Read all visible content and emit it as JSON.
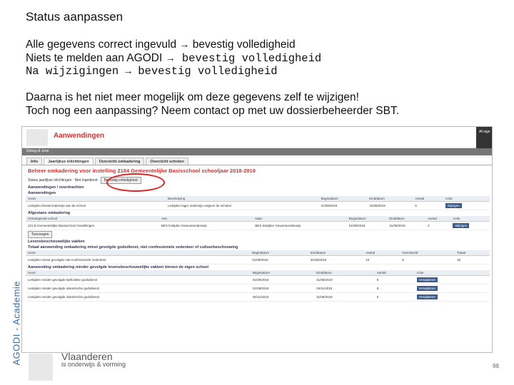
{
  "slide": {
    "title": "Status aanpassen",
    "side_label": "AGODI - Academie",
    "page_number": "98",
    "line1_text": "Alle gegevens correct ingevuld ",
    "line1_end": " bevestig volledigheid",
    "line2_text": "Niets te melden aan AGODI ",
    "line2_end": " bevestig volledigheid",
    "line3_text": "Na wijzigingen ",
    "line3_end": " bevestig volledigheid",
    "arrow": "→",
    "para1": "Daarna is het niet meer mogelijk om deze gegevens zelf te wijzigen!",
    "para2": "Toch nog een aanpassing? Neem contact op met uw dossierbeheerder SBT."
  },
  "app": {
    "title": "Aanwendingen",
    "user": "Debug & Jose",
    "top_right": "Af-sign",
    "tabs": [
      "Info",
      "Jaarlijkse inlichtingen",
      "Overzicht omkadering",
      "Overzicht scholen"
    ],
    "heading": "Beheer omkadering voor instelling 2184 Gemeentelijke Basisschool schooljaar 2018-2019",
    "status_label": "Status jaarlijkse inlichtingen : Niet ingediend",
    "confirm_button": "Bevestig volledigheid",
    "breadcrumb": "Aanwendingen / overdrachten",
    "sec1": "Aanwendingen",
    "sec1_cols": [
      "Soort",
      "Beschrijving",
      "Begindatum",
      "Einddatum",
      "Aantal",
      "Actie"
    ],
    "sec1_row": [
      "Lestijden kleuteronderwijs aan de school",
      "Lestijden lager onderwijs volgens de scholen",
      "01/09/2018",
      "31/08/2019",
      "6",
      "Wijzigen"
    ],
    "sec2": "Afgestane omkadering",
    "sec2_cols": [
      "Ontvangende school",
      "Aan",
      "Naar",
      "Begindatum",
      "Einddatum",
      "Aantal",
      "Actie"
    ],
    "sec2_row": [
      "221 B Gemeentelijke Basisschool Oostellingen",
      "BES lestijden Gewoneonderwijs",
      "BES lestijden Gewoneonderwijs",
      "01/09/2018",
      "31/08/2019",
      "2",
      "Wijzigen"
    ],
    "toevoegen": "Toevoegen",
    "sec3": "Levensbeschouwelijke vakken",
    "sec3_sub": "Totaal aanwending omkadering minst gevolgde godsdienst, niet confessionele zedenleer of cultuurbeschouwing",
    "sec3_cols": [
      "Soort",
      "Begindatum",
      "Einddatum",
      "Aantal",
      "Overdracht",
      "Totaal"
    ],
    "sec3_row": [
      "Lestijden meest gevolgde niet-confessionele zedenleer",
      "01/09/2018",
      "31/08/2019",
      "10",
      "8",
      "18"
    ],
    "sec4": "Aanwending omkadering minder gevolgde levensbeschouwelijke vakken binnen de eigen school",
    "sec4_cols": [
      "Soort",
      "Begindatum",
      "Einddatum",
      "Aantal",
      "Actie"
    ],
    "sec4_rows": [
      [
        "Lestijden minder gevolgde katholieke godsdienst",
        "01/09/2018",
        "31/08/2019",
        "8",
        "Verwijderen"
      ],
      [
        "Lestijden minder gevolgde islamitische godsdienst",
        "01/09/2018",
        "04/11/2018",
        "8",
        "Verwijderen"
      ],
      [
        "Lestijden minder gevolgde islamitische godsdienst",
        "05/11/2018",
        "31/08/2019",
        "6",
        "Verwijderen"
      ]
    ]
  },
  "footer": {
    "brand": "Vlaanderen",
    "sub": "is onderwijs & vorming"
  }
}
